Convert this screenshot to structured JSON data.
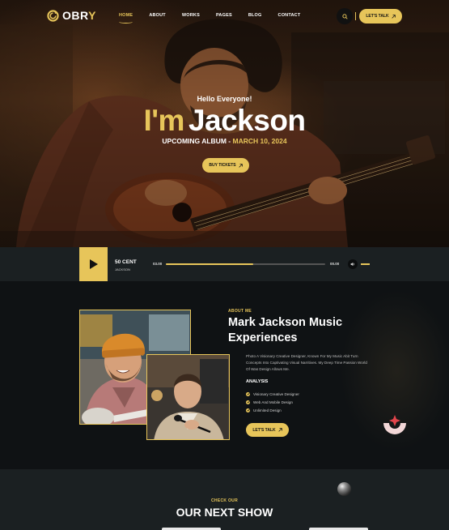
{
  "brand": {
    "name_prefix": "OBR",
    "name_accent": "Y"
  },
  "nav": {
    "items": [
      {
        "label": "HOME",
        "active": true
      },
      {
        "label": "ABOUT",
        "active": false
      },
      {
        "label": "WORKS",
        "active": false
      },
      {
        "label": "PAGES",
        "active": false
      },
      {
        "label": "BLOG",
        "active": false
      },
      {
        "label": "CONTACT",
        "active": false
      }
    ],
    "search_icon": "search-icon",
    "cta_label": "LET'S TALK"
  },
  "hero": {
    "greeting": "Hello Everyone!",
    "name_prefix": "I'm",
    "name": "Jackson",
    "album_label": "UPCOMING ALBUM -",
    "album_date": "MARCH 10, 2024",
    "button_label": "BUY TICKETS"
  },
  "player": {
    "track_title": "50 CENT",
    "track_artist": "JACKSON",
    "time_current": "03.00",
    "time_total": "00.00",
    "progress": 0.55
  },
  "about": {
    "kicker": "ABOUT ME",
    "title": "Mark Jackson Music Experiences",
    "description": "Photo A Visionary Creative Designer, Known For My Music Abit Turn Concepts Into Captivating Visual Narritives. My Deep Time Passion World Of Was Design Allows Me.",
    "analysis_title": "ANALYSIS",
    "checklist": [
      "Visionary Creative Designer",
      "Web And Mobile Design",
      "Unlimited Design"
    ],
    "button_label": "LET'S TALK"
  },
  "shows": {
    "kicker": "CHECK OUR",
    "title": "OUR NEXT SHOW"
  },
  "colors": {
    "accent": "#e7c55a",
    "dark": "#0f1214",
    "panel": "#1b2022"
  }
}
